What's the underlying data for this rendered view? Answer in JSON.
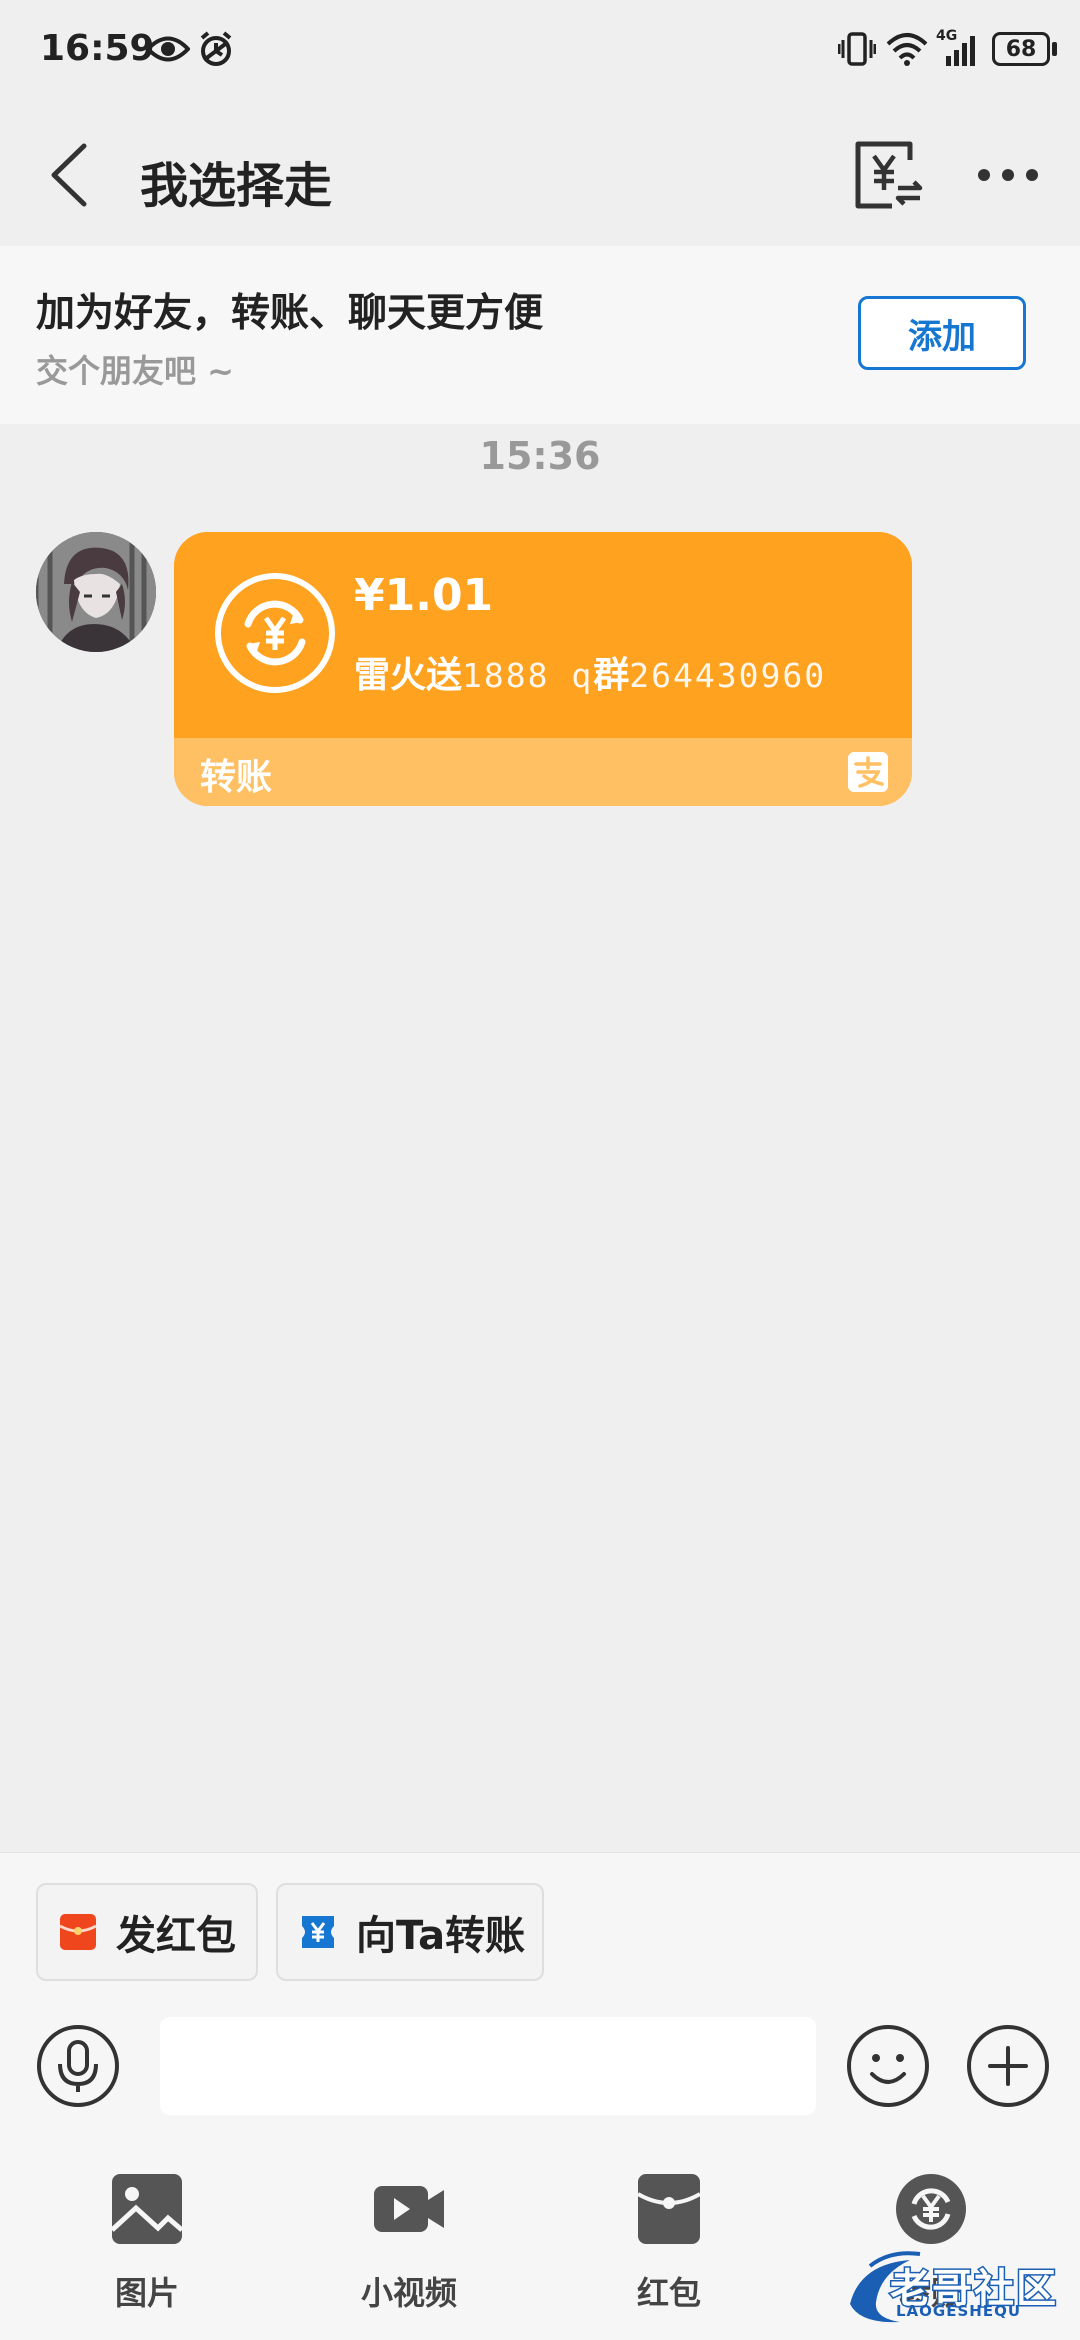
{
  "status_bar": {
    "time": "16:59",
    "battery": "68",
    "network": "4G"
  },
  "header": {
    "title": "我选择走"
  },
  "friend_banner": {
    "title": "加为好友，转账、聊天更方便",
    "subtitle": "交个朋友吧 ~",
    "add_label": "添加"
  },
  "chat": {
    "timestamp": "15:36",
    "messages": [
      {
        "type": "transfer",
        "amount": "¥1.01",
        "note_bold": "雷火送",
        "note_mono": "1888 q",
        "note_bold2": "群",
        "note_mono2": "264430960",
        "label": "转账",
        "accent": "#ffa21f"
      }
    ]
  },
  "quick_actions": {
    "red_packet": "发红包",
    "transfer": "向Ta转账"
  },
  "input": {
    "placeholder": ""
  },
  "tools": {
    "photo": "图片",
    "video": "小视频",
    "red_packet": "红包",
    "transfer": "转账"
  },
  "watermark": {
    "text": "老哥社区",
    "sub": "LAOGESHEQU"
  },
  "colors": {
    "accent_blue": "#1677d2",
    "transfer_orange": "#ffa21f",
    "red_packet": "#f0461e"
  }
}
